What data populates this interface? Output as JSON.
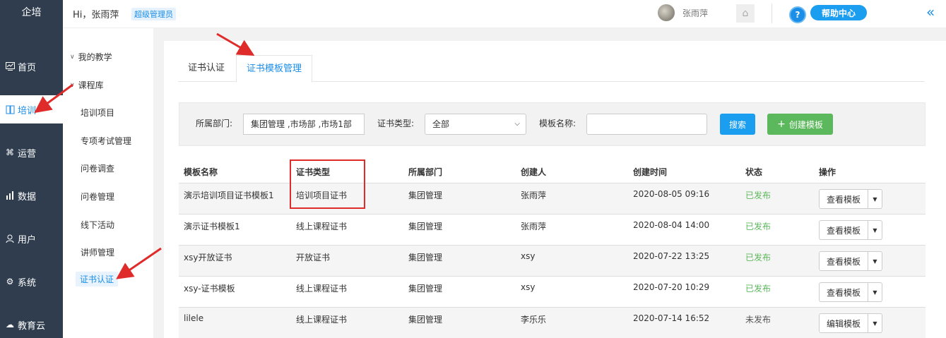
{
  "leftnav": {
    "brand": "企培",
    "items": [
      {
        "label": "首页",
        "icon": "dashboard-icon"
      },
      {
        "label": "培训",
        "icon": "training-icon"
      },
      {
        "label": "运营",
        "icon": "operations-icon"
      },
      {
        "label": "数据",
        "icon": "data-chart-icon"
      },
      {
        "label": "用户",
        "icon": "user-icon"
      },
      {
        "label": "系统",
        "icon": "gear-icon"
      },
      {
        "label": "教育云",
        "icon": "cloud-icon"
      }
    ],
    "active": "培训"
  },
  "subnav": {
    "groups": [
      "我的教学",
      "课程库"
    ],
    "items": [
      "培训项目",
      "专项考试管理",
      "问卷调查",
      "问卷管理",
      "线下活动",
      "讲师管理",
      "证书认证"
    ],
    "active": "证书认证"
  },
  "header": {
    "greeting": "Hi，张雨萍",
    "role": "超级管理员",
    "username": "张雨萍",
    "help_label": "帮助中心",
    "help_q": "?"
  },
  "tabs": [
    {
      "label": "证书认证"
    },
    {
      "label": "证书模板管理",
      "active": true
    }
  ],
  "filter": {
    "dept_label": "所属部门:",
    "dept_value": "集团管理 ,市场部 ,市场1部",
    "type_label": "证书类型:",
    "type_value": "全部",
    "name_label": "模板名称:",
    "name_value": "",
    "search_label": "搜索",
    "create_label": "创建模板"
  },
  "table": {
    "columns": [
      "模板名称",
      "证书类型",
      "所属部门",
      "创建人",
      "创建时间",
      "状态",
      "操作"
    ],
    "rows": [
      {
        "name": "演示培训项目证书模板1",
        "type": "培训项目证书",
        "dept": "集团管理",
        "creator": "张雨萍",
        "time": "2020-08-05 09:16",
        "status": "已发布",
        "action": "查看模板"
      },
      {
        "name": "演示证书模板1",
        "type": "线上课程证书",
        "dept": "集团管理",
        "creator": "张雨萍",
        "time": "2020-08-04 14:00",
        "status": "已发布",
        "action": "查看模板"
      },
      {
        "name": "xsy开放证书",
        "type": "开放证书",
        "dept": "集团管理",
        "creator": "xsy",
        "time": "2020-07-22 13:25",
        "status": "已发布",
        "action": "查看模板"
      },
      {
        "name": "xsy-证书模板",
        "type": "线上课程证书",
        "dept": "集团管理",
        "creator": "xsy",
        "time": "2020-07-20 10:29",
        "status": "已发布",
        "action": "查看模板"
      },
      {
        "name": "lilele",
        "type": "线上课程证书",
        "dept": "集团管理",
        "creator": "李乐乐",
        "time": "2020-07-14 16:52",
        "status": "未发布",
        "action": "编辑模板"
      }
    ]
  },
  "colors": {
    "nav_bg": "#2f3d4f",
    "accent": "#1b8ee8",
    "published": "#5cb85c",
    "annotation": "#e02b2b"
  }
}
